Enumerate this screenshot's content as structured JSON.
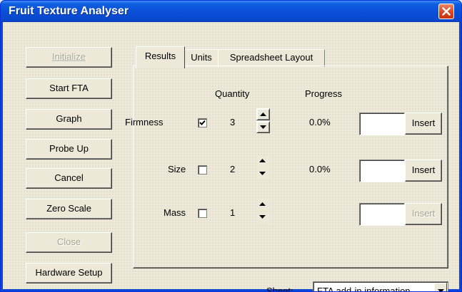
{
  "window": {
    "title": "Fruit Texture Analyser",
    "close_glyph": "close-icon"
  },
  "sidebar": {
    "buttons": [
      {
        "label": "Initialize",
        "enabled": false
      },
      {
        "label": "Start FTA",
        "enabled": true
      },
      {
        "label": "Graph",
        "enabled": true
      },
      {
        "label": "Probe Up",
        "enabled": true
      },
      {
        "label": "Cancel",
        "enabled": true
      },
      {
        "label": "Zero Scale",
        "enabled": true
      },
      {
        "label": "Close",
        "enabled": false
      },
      {
        "label": "Hardware Setup",
        "enabled": true
      }
    ]
  },
  "tabs": [
    {
      "label": "Results",
      "active": true
    },
    {
      "label": "Units",
      "active": false
    },
    {
      "label": "Spreadsheet Layout",
      "active": false
    }
  ],
  "results": {
    "quantity_header": "Quantity",
    "progress_header": "Progress",
    "rows": [
      {
        "label": "Firmness",
        "checked": true,
        "quantity": "3",
        "progress": "0.0%",
        "input_value": "",
        "insert_label": "Insert",
        "insert_enabled": true
      },
      {
        "label": "Size",
        "checked": false,
        "quantity": "2",
        "progress": "0.0%",
        "input_value": "",
        "insert_label": "Insert",
        "insert_enabled": true
      },
      {
        "label": "Mass",
        "checked": false,
        "quantity": "1",
        "progress": "",
        "input_value": "",
        "insert_label": "Insert",
        "insert_enabled": false
      }
    ]
  },
  "sheet": {
    "label": "Sheet:",
    "selected": "FTA add-in information"
  },
  "colors": {
    "title_bar": "#0a4ed6",
    "dialog_bg": "#ece9d8",
    "close_button": "#d8431c",
    "disabled_text": "#a7a595"
  }
}
